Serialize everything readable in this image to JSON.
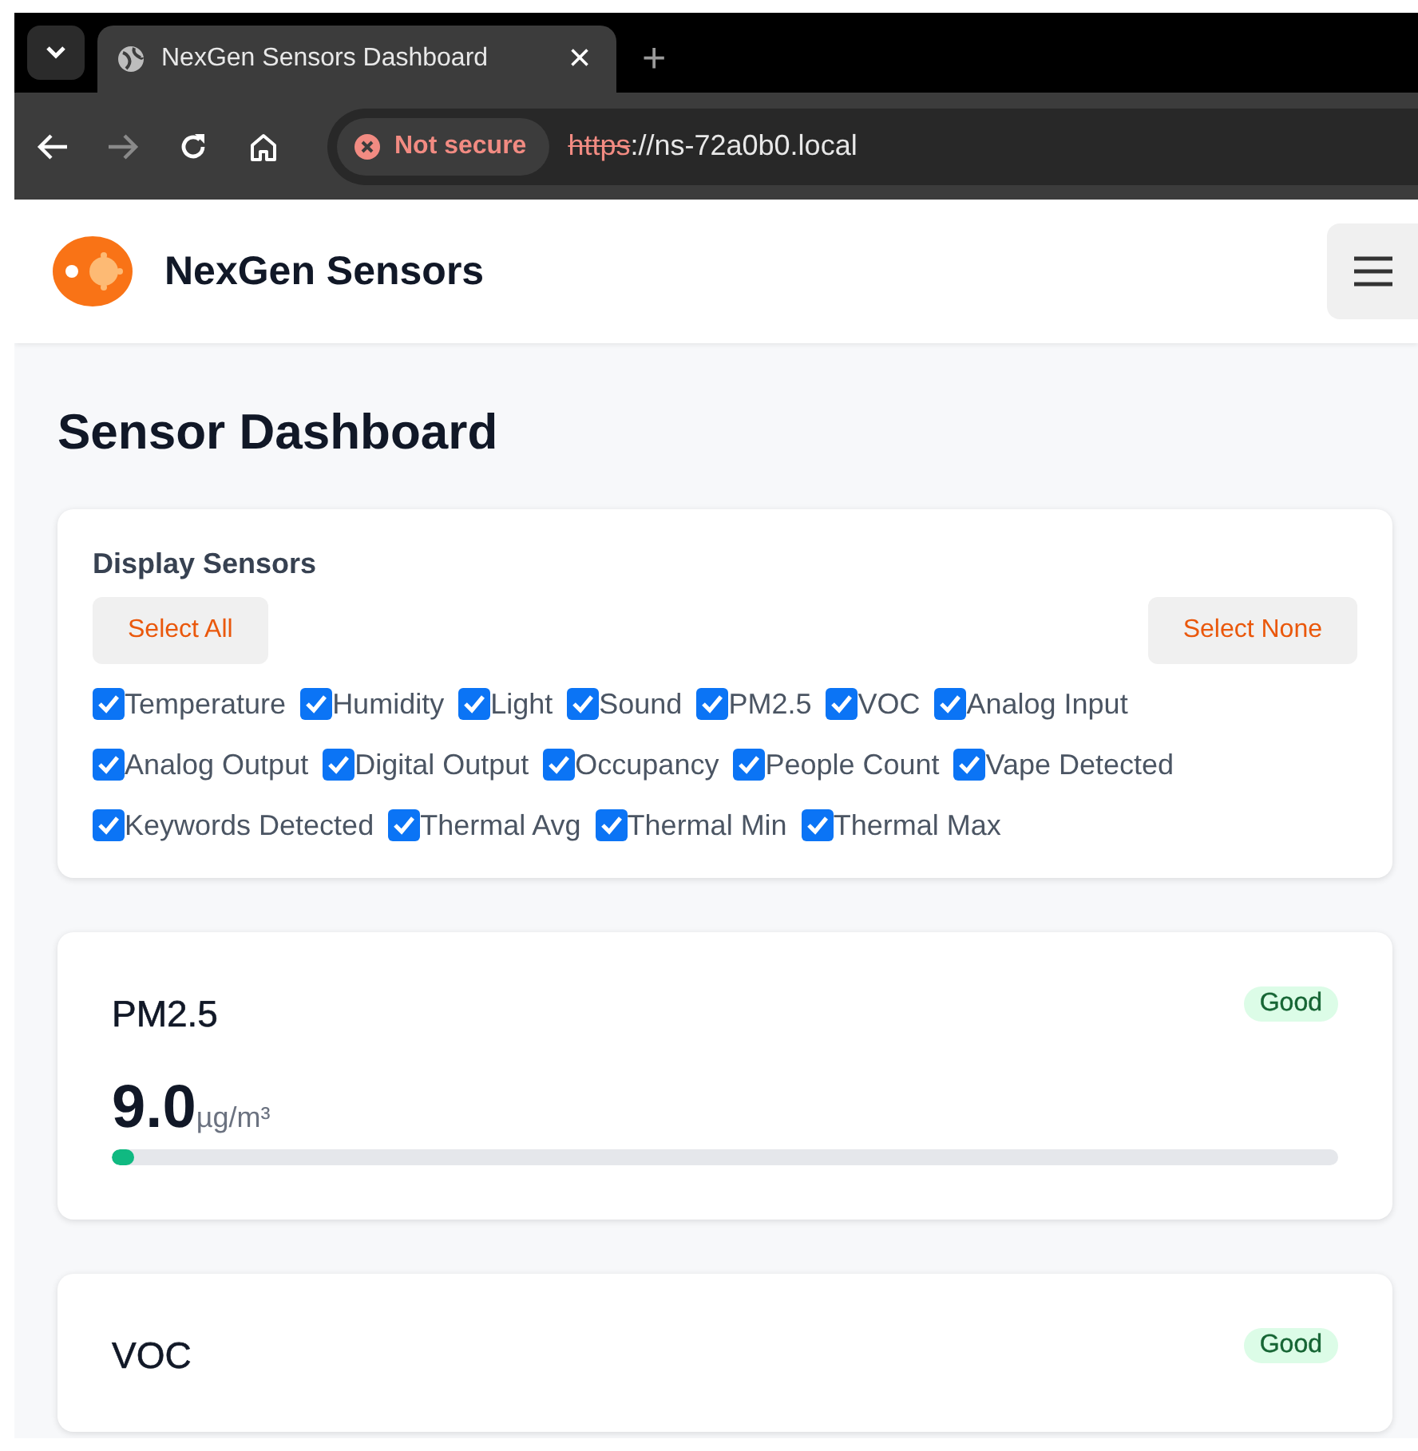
{
  "browser": {
    "tab_title": "NexGen Sensors Dashboard",
    "close": "×",
    "new_tab": "+",
    "security": "Not secure",
    "url_scheme": "https",
    "url_rest": "://ns-72a0b0.local"
  },
  "header": {
    "brand": "NexGen Sensors"
  },
  "page_title": "Sensor Dashboard",
  "filter": {
    "title": "Display Sensors",
    "buttons": [
      "Select All",
      "Select None"
    ],
    "sensors": [
      {
        "label": "Temperature",
        "checked": true
      },
      {
        "label": "Humidity",
        "checked": true
      },
      {
        "label": "Light",
        "checked": true
      },
      {
        "label": "Sound",
        "checked": true
      },
      {
        "label": "PM2.5",
        "checked": true
      },
      {
        "label": "VOC",
        "checked": true
      },
      {
        "label": "Analog Input",
        "checked": true
      },
      {
        "label": "Analog Output",
        "checked": true
      },
      {
        "label": "Digital Output",
        "checked": true
      },
      {
        "label": "Occupancy",
        "checked": true
      },
      {
        "label": "People Count",
        "checked": true
      },
      {
        "label": "Vape Detected",
        "checked": true
      },
      {
        "label": "Keywords Detected",
        "checked": true
      },
      {
        "label": "Thermal Avg",
        "checked": true
      },
      {
        "label": "Thermal Min",
        "checked": true
      },
      {
        "label": "Thermal Max",
        "checked": true
      }
    ]
  },
  "cards": [
    {
      "name": "PM2.5",
      "status": "Good",
      "value": "9.0",
      "unit": "µg/m³",
      "level": 0.015
    },
    {
      "name": "VOC",
      "status": "Good"
    }
  ]
}
